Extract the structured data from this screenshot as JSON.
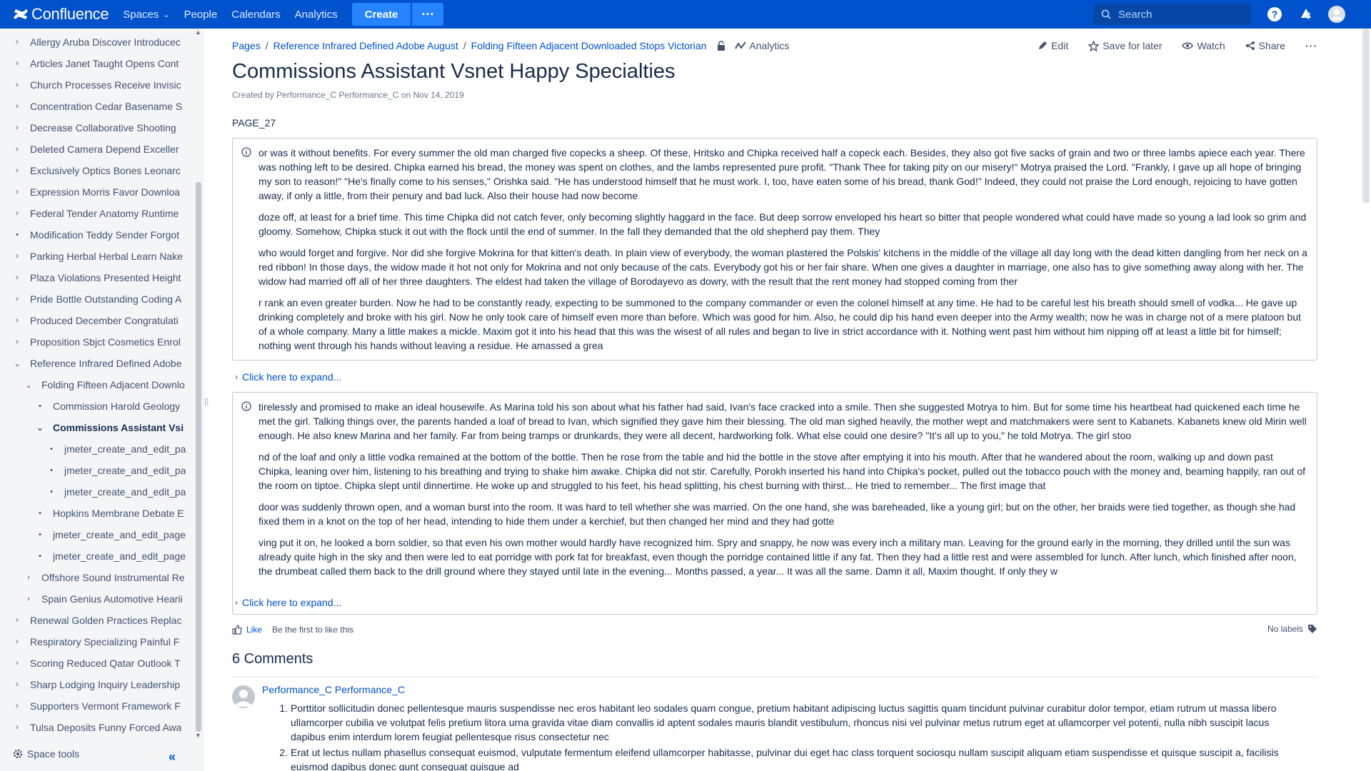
{
  "topbar": {
    "logo_text": "Confluence",
    "nav": [
      "Spaces",
      "People",
      "Calendars",
      "Analytics"
    ],
    "create_label": "Create",
    "more_label": "···",
    "search_placeholder": "Search",
    "colors": {
      "bar": "#0052cc",
      "create": "#2684ff"
    }
  },
  "sidebar": {
    "items": [
      {
        "label": "Allergy Aruba Discover Introducec",
        "toggle": "›"
      },
      {
        "label": "Articles Janet Taught Opens Cont",
        "toggle": "›"
      },
      {
        "label": "Church Processes Receive Invisic",
        "toggle": "›"
      },
      {
        "label": "Concentration Cedar Basename S",
        "toggle": "›"
      },
      {
        "label": "Decrease Collaborative Shooting",
        "toggle": "›"
      },
      {
        "label": "Deleted Camera Depend Exceller",
        "toggle": "›"
      },
      {
        "label": "Exclusively Optics Bones Leonarc",
        "toggle": "›"
      },
      {
        "label": "Expression Morris Favor Downloa",
        "toggle": "›"
      },
      {
        "label": "Federal Tender Anatomy Runtime",
        "toggle": "›"
      },
      {
        "label": "Modification Teddy Sender Forgot",
        "toggle": "•"
      },
      {
        "label": "Parking Herbal Herbal Learn Nake",
        "toggle": "›"
      },
      {
        "label": "Plaza Violations Presented Height",
        "toggle": "›"
      },
      {
        "label": "Pride Bottle Outstanding Coding A",
        "toggle": "›"
      },
      {
        "label": "Produced December Congratulati",
        "toggle": "›"
      },
      {
        "label": "Proposition Sbjct Cosmetics Enrol",
        "toggle": "›"
      },
      {
        "label": "Reference Infrared Defined Adobe",
        "toggle": "⌄"
      },
      {
        "label": "Folding Fifteen Adjacent Downlo",
        "toggle": "⌄"
      },
      {
        "label": "Commission Harold Geology",
        "toggle": "•"
      },
      {
        "label": "Commissions Assistant Vsi",
        "toggle": "⌄"
      },
      {
        "label": "jmeter_create_and_edit_pa",
        "toggle": "•"
      },
      {
        "label": "jmeter_create_and_edit_pa",
        "toggle": "•"
      },
      {
        "label": "jmeter_create_and_edit_pa",
        "toggle": "•"
      },
      {
        "label": "Hopkins Membrane Debate E",
        "toggle": "•"
      },
      {
        "label": "jmeter_create_and_edit_page",
        "toggle": "•"
      },
      {
        "label": "jmeter_create_and_edit_page",
        "toggle": "•"
      },
      {
        "label": "Offshore Sound Instrumental Re",
        "toggle": "›"
      },
      {
        "label": "Spain Genius Automotive Hearii",
        "toggle": "›"
      },
      {
        "label": "Renewal Golden Practices Replac",
        "toggle": "›"
      },
      {
        "label": "Respiratory Specializing Painful F",
        "toggle": "›"
      },
      {
        "label": "Scoring Reduced Qatar Outlook T",
        "toggle": "›"
      },
      {
        "label": "Sharp Lodging Inquiry Leadership",
        "toggle": "›"
      },
      {
        "label": "Supporters Vermont Framework F",
        "toggle": "›"
      },
      {
        "label": "Tulsa Deposits Funny Forced Awa",
        "toggle": "›"
      }
    ],
    "space_tools_label": "Space tools",
    "collapse_label": "«",
    "resizer_label": "||"
  },
  "breadcrumb": {
    "items": [
      "Pages",
      "Reference Infrared Defined Adobe August",
      "Folding Fifteen Adjacent Downloaded Stops Victorian"
    ],
    "separator": "/",
    "analytics_label": "Analytics"
  },
  "actions": {
    "edit": "Edit",
    "save": "Save for later",
    "watch": "Watch",
    "share": "Share",
    "more": "···"
  },
  "page": {
    "title": "Commissions Assistant Vsnet Happy Specialties",
    "byline": "Created by Performance_C Performance_C on Nov 14, 2019",
    "label": "PAGE_27"
  },
  "panels": [
    {
      "paragraphs": [
        "or was it without benefits. For every summer the old man charged five copecks a sheep. Of these, Hritsko and Chipka received half a copeck each. Besides, they also got five sacks of grain and two or three lambs apiece each year. There was nothing left to be desired. Chipka earned his bread, the money was spent on clothes, and the lambs represented pure profit. \"Thank Thee for taking pity on our misery!\" Motrya praised the Lord. \"Frankly, I gave up all hope of bringing my son to reason!\" \"He's finally come to his senses,\" Orishka said. \"He has understood himself that he must work. I, too, have eaten some of his bread, thank God!\" Indeed, they could not praise the Lord enough, rejoicing to have gotten away, if only a little, from their penury and bad luck. Also their house had now become",
        "doze off, at least for a brief time. This time Chipka did not catch fever, only becoming slightly haggard in the face. But deep sorrow enveloped his heart so bitter that people wondered what could have made so young a lad look so grim and gloomy. Somehow, Chipka stuck it out with the flock until the end of summer. In the fall they demanded that the old shepherd pay them. They",
        "who would forget and forgive. Nor did she forgive Mokrina for that kitten's death. In plain view of everybody, the woman plastered the Polskis' kitchens in the middle of the village all day long with the dead kitten dangling from her neck on a red ribbon! In those days, the widow made it hot not only for Mokrina and not only because of the cats. Everybody got his or her fair share. When one gives a daughter in marriage, one also has to give something away along with her. The widow had married off all of her three daughters. The eldest had taken the village of Borodayevo as dowry, with the result that the rent money had stopped coming from ther",
        "r rank an even greater burden. Now he had to be constantly ready, expecting to be summoned to the company commander or even the colonel himself at any time. He had to be careful lest his breath should smell of vodka... He gave up drinking completely and broke with his girl. Now he only took care of himself even more than before. Which was good for him. Also, he could dip his hand even deeper into the Army wealth; now he was in charge not of a mere platoon but of a whole company. Many a little makes a mickle. Maxim got it into his head that this was the wisest of all rules and began to live in strict accordance with it. Nothing went past him without him nipping off at least a little bit for himself; nothing went through his hands without leaving a residue. He amassed a grea"
      ]
    },
    {
      "paragraphs": [
        "tirelessly and promised to make an ideal housewife. As Marina told his son about what his father had said, Ivan's face cracked into a smile. Then she suggested Motrya to him. But for some time his heartbeat had quickened each time he met the girl. Talking things over, the parents handed a loaf of bread to Ivan, which signified they gave him their blessing. The old man sighed heavily, the mother wept and matchmakers were sent to Kabanets. Kabanets knew old Mirin well enough. He also knew Marina and her family. Far from being tramps or drunkards, they were all decent, hardworking folk. What else could one desire? \"It's all up to you,\" he told Motrya. The girl stoo",
        "nd of the loaf and only a little vodka remained at the bottom of the bottle. Then he rose from the table and hid the bottle in the stove after emptying it into his mouth. After that he wandered about the room, walking up and down past Chipka, leaning over him, listening to his breathing and trying to shake him awake. Chipka did not stir. Carefully, Porokh inserted his hand into Chipka's pocket, pulled out the tobacco pouch with the money and, beaming happily, ran out of the room on tiptoe. Chipka slept until dinnertime. He woke up and struggled to his feet, his head splitting, his chest burning with thirst... He tried to remember... The first image that",
        "door was suddenly thrown open, and a woman burst into the room. It was hard to tell whether she was married. On the one hand, she was bareheaded, like a young girl; but on the other, her braids were tied together, as though she had fixed them in a knot on the top of her head, intending to hide them under a kerchief, but then changed her mind and they had gotte",
        "ving put it on, he looked a born soldier, so that even his own mother would hardly have recognized him. Spry and snappy, he now was every inch a military man. Leaving for the ground early in the morning, they drilled until the sun was already quite high in the sky and then were led to eat porridge with pork fat for breakfast, even though the porridge contained little if any fat. Then they had a little rest and were assembled for lunch. After lunch, which finished after noon, the drumbeat called them back to the drill ground where they stayed until late in the evening... Months passed, a year... It was all the same. Damn it all, Maxim thought. If only they w"
      ]
    }
  ],
  "expand_label": "Click here to expand...",
  "like": {
    "button": "Like",
    "text": "Be the first to like this",
    "labels": "No labels"
  },
  "comments": {
    "title": "6 Comments",
    "author": "Performance_C Performance_C",
    "items": [
      "Porttitor sollicitudin donec pellentesque mauris suspendisse nec eros habitant leo sodales quam congue, pretium habitant adipiscing luctus sagittis quam tincidunt pulvinar curabitur dolor tempor, etiam rutrum ut massa libero ullamcorper cubilia ve volutpat felis pretium litora urna gravida vitae diam convallis id aptent sodales mauris blandit vestibulum, rhoncus nisi vel pulvinar metus rutrum eget at ullamcorper vel potenti, nulla nibh suscipit lacus dapibus enim interdum lorem feugiat pellentesque risus consectetur nec",
      "Erat ut lectus nullam phasellus consequat euismod, vulputate fermentum eleifend ullamcorper habitasse, pulvinar dui eget hac class torquent sociosqu nullam suscipit aliquam etiam suspendisse et quisque suscipit a, facilisis euismod dapibus donec qunt consequat quisque ad"
    ]
  }
}
